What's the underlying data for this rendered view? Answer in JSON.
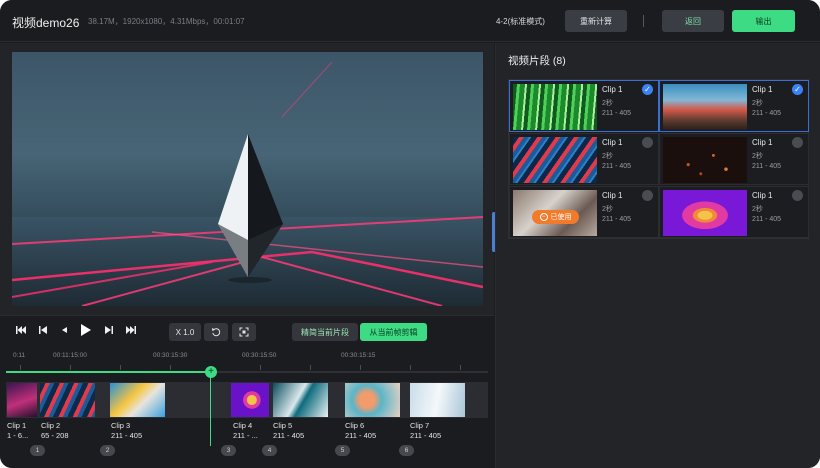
{
  "header": {
    "title": "视频demo26",
    "meta": "38.17M，1920x1080，4.31Mbps，00:01:07",
    "mode": "4-2(标准模式)",
    "recalc_label": "重新计算",
    "back_label": "返回",
    "export_label": "输出"
  },
  "controls": {
    "speed": "X 1.0",
    "precise_label": "精简当前片段",
    "cut_label": "从当前帧剪辑"
  },
  "timeline": {
    "ruler": [
      "0:11",
      "00:11:15:00",
      "00:30:15:30",
      "00:30:15:50",
      "00:30:15:15"
    ],
    "clips": [
      {
        "name": "Clip 1",
        "range": "1 - 6..."
      },
      {
        "name": "Clip 2",
        "range": "65 - 208"
      },
      {
        "name": "Clip 3",
        "range": "211 - 405"
      },
      {
        "name": "Clip 4",
        "range": "211 - ..."
      },
      {
        "name": "Clip 5",
        "range": "211 - 405"
      },
      {
        "name": "Clip 6",
        "range": "211 - 405"
      },
      {
        "name": "Clip 7",
        "range": "211 - 405"
      }
    ],
    "numbers": [
      "1",
      "2",
      "3",
      "4",
      "5",
      "6"
    ]
  },
  "panel": {
    "title": "视频片段 (8)",
    "used_label": "已使用",
    "items": [
      {
        "title": "Clip 1",
        "duration": "2秒",
        "range": "211 - 405",
        "checked": true
      },
      {
        "title": "Clip 1",
        "duration": "2秒",
        "range": "211 - 405",
        "checked": true
      },
      {
        "title": "Clip 1",
        "duration": "2秒",
        "range": "211 - 405",
        "checked": false
      },
      {
        "title": "Clip 1",
        "duration": "2秒",
        "range": "211 - 405",
        "checked": false
      },
      {
        "title": "Clip 1",
        "duration": "2秒",
        "range": "211 - 405",
        "checked": false
      },
      {
        "title": "Clip 1",
        "duration": "2秒",
        "range": "211 - 405",
        "checked": false
      }
    ]
  },
  "icons": {
    "skip_start": "skip-to-start-icon",
    "prev_frame": "previous-frame-icon",
    "step_back": "step-back-icon",
    "play": "play-icon",
    "next_frame": "next-frame-icon",
    "skip_end": "skip-to-end-icon",
    "rotate": "rotate-icon",
    "fit": "fit-screen-icon",
    "check": "check-icon",
    "add": "add-icon"
  },
  "colors": {
    "accent_green": "#3ddc84",
    "selected_blue": "#3b82f6",
    "used_orange": "#f27a2b"
  }
}
